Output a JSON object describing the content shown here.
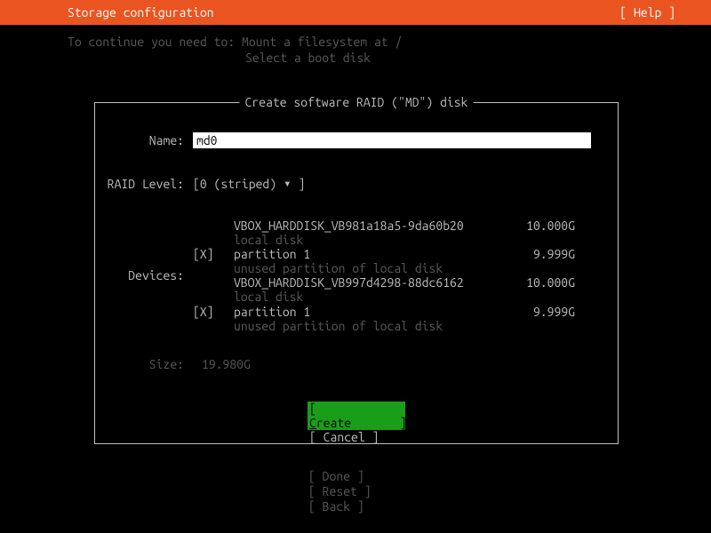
{
  "header": {
    "title": "Storage configuration",
    "help": "[ Help ]"
  },
  "continue": {
    "prefix": "To continue you need to: ",
    "line1": "Mount a filesystem at /",
    "line2": "Select a boot disk"
  },
  "dialog": {
    "title": " Create software RAID (\"MD\") disk ",
    "name_label": "Name:",
    "name_value": "md0",
    "raid_label": "RAID Level:",
    "raid_open": "[ ",
    "raid_value": "0 (striped)",
    "raid_arrow": "▾",
    "raid_close": " ]",
    "devices_label": "Devices:",
    "size_label": "Size:",
    "size_value": "19.980G",
    "create_btn": "[ Create       ]",
    "cancel_btn": "[ Cancel       ]"
  },
  "devices": [
    {
      "disk": "VBOX_HARDDISK_VB981a18a5-9da60b20",
      "disk_size": "10.000G",
      "disk_sub": "local disk",
      "checkbox": "[X]",
      "part_name": "partition 1",
      "part_size": "9.999G",
      "part_sub": "unused partition of local disk"
    },
    {
      "disk": "VBOX_HARDDISK_VB997d4298-88dc6162",
      "disk_size": "10.000G",
      "disk_sub": "local disk",
      "checkbox": "[X]",
      "part_name": "partition 1",
      "part_size": "9.999G",
      "part_sub": "unused partition of local disk"
    }
  ],
  "footer": {
    "done": "[ Done         ]",
    "reset": "[ Reset        ]",
    "back": "[ Back         ]"
  }
}
